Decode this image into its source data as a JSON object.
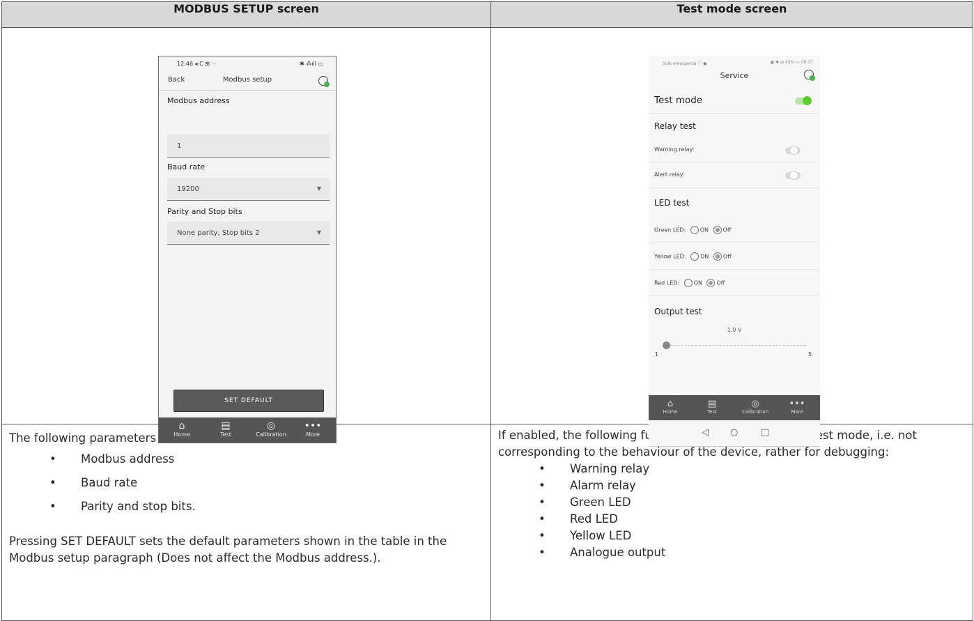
{
  "headers": {
    "left": "MODBUS SETUP screen",
    "right": "Test mode screen"
  },
  "phone1": {
    "status_left": "12:46 ◂ C ⊞ ··",
    "status_right": "✱ ⁂ıll ▭",
    "back": "Back",
    "title": "Modbus setup",
    "address_label": "Modbus address",
    "address_value": "1",
    "baud_label": "Baud rate",
    "baud_value": "19200",
    "parity_label": "Parity and Stop bits",
    "parity_value": "None parity, Stop bits 2",
    "set_default": "SET DEFAULT",
    "tabs": [
      "Home",
      "Test",
      "Calibration",
      "More"
    ]
  },
  "phone2": {
    "status_left": "Sole emergenza ⓘ ●",
    "status_right": "▣ ✱ ⊞ 45% ▭ 08:37",
    "title": "Service",
    "test_mode": "Test mode",
    "test_mode_on": true,
    "relay_test": "Relay test",
    "warning_relay": "Warning relay:",
    "alert_relay": "Alert relay:",
    "led_test": "LED test",
    "green_led": "Green LED:",
    "yellow_led": "Yellow LED:",
    "red_led": "Red LED:",
    "on": "ON",
    "off": "Off",
    "output_test": "Output test",
    "slider_value_label": "1.0 V",
    "slider_value": 1.0,
    "slider_min": "1",
    "slider_max": "5",
    "tabs": [
      "Home",
      "Test",
      "Calibration",
      "More"
    ],
    "nav": [
      "◁",
      "○",
      "□"
    ]
  },
  "left_desc": {
    "intro": "The following parameters can be set:",
    "items": [
      "Modbus address",
      "Baud rate",
      "Parity and stop bits."
    ],
    "note": "Pressing SET DEFAULT sets the default parameters shown in the table in the Modbus setup paragraph (Does not affect the Modbus address.)."
  },
  "right_desc": {
    "intro": "If enabled, the following functions can be activated in test mode, i.e. not corresponding to the behaviour of the device, rather for debugging:",
    "items": [
      "Warning relay",
      "Alarm relay",
      "Green LED",
      "Red LED",
      "Yellow LED",
      "Analogue output"
    ]
  }
}
